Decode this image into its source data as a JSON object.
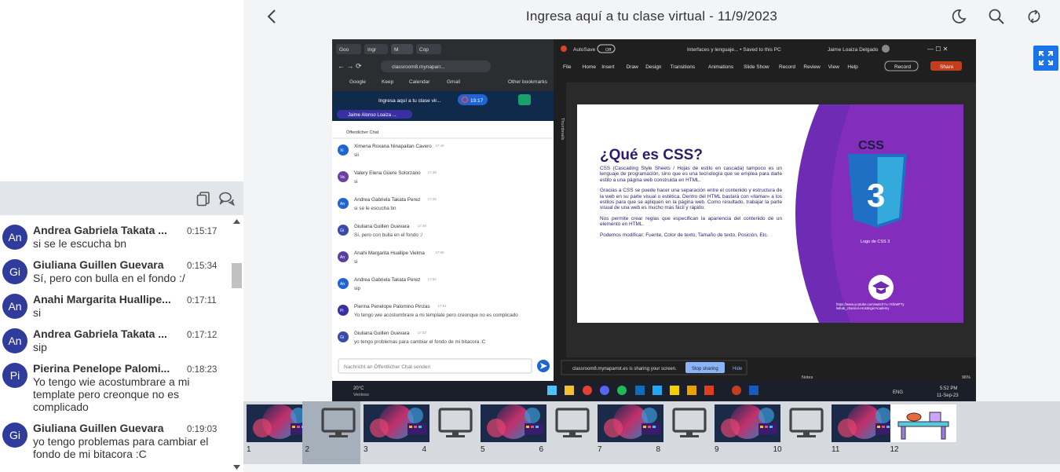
{
  "chat": {
    "messages": [
      {
        "initials": "An",
        "name": "Andrea Gabriela Takata ...",
        "time": "0:15:17",
        "text": "si se le escucha bn"
      },
      {
        "initials": "Gi",
        "name": "Giuliana Guillen Guevara",
        "time": "0:15:34",
        "text": "Sí, pero con bulla en el fondo :/"
      },
      {
        "initials": "An",
        "name": "Anahi Margarita Huallipe...",
        "time": "0:17:11",
        "text": "si"
      },
      {
        "initials": "An",
        "name": "Andrea Gabriela Takata ...",
        "time": "0:17:12",
        "text": "sip"
      },
      {
        "initials": "Pi",
        "name": "Pierina Penelope Palomi...",
        "time": "0:18:23",
        "text": "Yo tengo wie acostumbrare a mi template pero creonque no es complicado"
      },
      {
        "initials": "Gi",
        "name": "Giuliana Guillen Guevara",
        "time": "0:19:03",
        "text": "yo tengo problemas para cambiar el fondo de mi bitacora :C"
      }
    ]
  },
  "header": {
    "title": "Ingresa aquí a tu clase virtual - 11/9/2023"
  },
  "slide": {
    "browser": {
      "tabs": [
        "Goo",
        "Ingr",
        "M",
        "Cop"
      ],
      "url": "classroom8.mynaparr...",
      "bookmarks": [
        "Google",
        "Keep",
        "Calendar",
        "Gmail",
        "Other bookmarks"
      ],
      "room_title": "Ingresa aquí a tu clase vir...",
      "timer": "19:17",
      "presenter": "Jaime Alonso Loaiza ...",
      "chat_label": "Öffentlicher Chat",
      "messages": [
        {
          "i": "Xi",
          "name": "Ximena Roxana Ninapaitan Cavero",
          "time": "17:40",
          "text": "sii"
        },
        {
          "i": "Va",
          "name": "Valery Elena Güere Solorzano",
          "time": "17:46",
          "text": "si"
        },
        {
          "i": "An",
          "name": "Andrea Gabriela Takata Perez",
          "time": "17:46",
          "text": "si se le escucha bn"
        },
        {
          "i": "Gi",
          "name": "Giuliana Guillen Guevara",
          "time": "17:46",
          "text": "Sí, pero con bulla en el fondo :/"
        },
        {
          "i": "An",
          "name": "Anahi Margarita Huallipe Vielma",
          "time": "17:50",
          "text": "si"
        },
        {
          "i": "An",
          "name": "Andrea Gabriela Takata Perez",
          "time": "17:50",
          "text": "sip"
        },
        {
          "i": "Pi",
          "name": "Pierina Penelope Palomino Pinzas",
          "time": "17:51",
          "text": "Yo tengo wie acostumbrare a mi template pero creonque no es complicado"
        },
        {
          "i": "Gi",
          "name": "Giuliana Guillen Guevara",
          "time": "17:52",
          "text": "yo tengo problemas para cambiar el fondo de mi bitacora :C"
        }
      ],
      "input_placeholder": "Nachricht an Öffentlicher Chat senden",
      "weather_temp": "20°C",
      "weather_desc": "Ventoso"
    },
    "ppt": {
      "autosave": "AutoSave",
      "autosave_state": "Off",
      "filename": "Interfaces y lenguaje... • Saved to this PC",
      "user": "Jaime Loaiza Delgado",
      "menu": [
        "File",
        "Home",
        "Insert",
        "Draw",
        "Design",
        "Transitions",
        "Animations",
        "Slide Show",
        "Record",
        "Review",
        "View",
        "Help"
      ],
      "record": "Record",
      "share": "Share",
      "thumbnails_label": "Thumbnails",
      "heading": "¿Qué es CSS?",
      "para1": "CSS (Cascading Style Sheets / Hojas de estilo en cascada) tampoco es un lenguaje de programación, sino que es una tecnología que se emplea para darle estilo a una página web construida en HTML.",
      "para2": "Gracias a CSS se puede hacer una separación entre el contenido y estructura de la web en su parte visual o estética. Dentro del HTML bastará con «llamar» a los estilos para que se apliquen en la página web. Como resultado, trabajar la parte visual de una web es mucho más fácil y rápido.",
      "para3": "Nos permite crear reglas que especifican la apariencia del contenido de un elemento en HTML.",
      "para4": "Podemos modificar: Fuente, Color de texto, Tamaño de texto, Posición, Etc.",
      "logo_word": "CSS",
      "logo_num": "3",
      "logo_caption": "Logo de CSS 3",
      "link": "https://www.youtube.com/watch?v=YDkWFTy lwhab_channel=HostingerAcademy",
      "sharing_text": "classroom8.mynaparrot.es is sharing your screen.",
      "stop_sharing": "Stop sharing",
      "hide": "Hide",
      "notes": "Notes",
      "zoom": "96%",
      "lang": "ENG",
      "clock_time": "5:52 PM",
      "clock_date": "11-Sep-23"
    }
  },
  "thumbs": [
    "1",
    "2",
    "3",
    "4",
    "5",
    "6",
    "7",
    "8",
    "9",
    "10",
    "11",
    "12"
  ],
  "colors": {
    "accent": "#1a73e8",
    "avatar": "#2f3c9c",
    "purple": "#6e2bb3",
    "css_blue": "#1f6fc4"
  }
}
